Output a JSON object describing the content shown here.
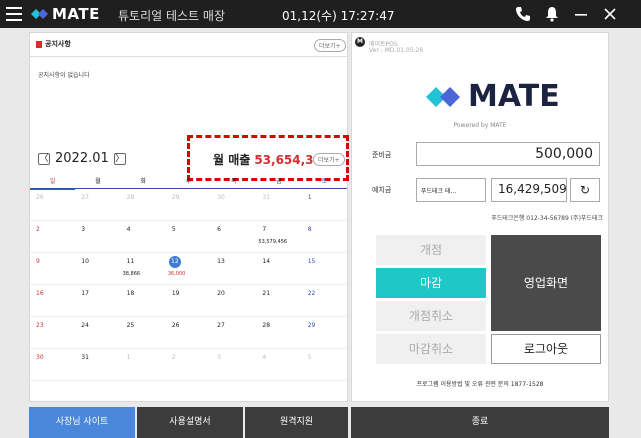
{
  "topbar": {
    "brand": "MATE",
    "store_name": "튜토리얼 테스트 매장",
    "clock": "01,12(수) 17:27:47",
    "icons": [
      "menu-icon",
      "phone-icon",
      "bell-icon",
      "minimize-icon",
      "close-icon"
    ]
  },
  "notice": {
    "title": "공지사항",
    "more": "더보기+",
    "empty": "공지사항이 없습니다"
  },
  "calendar": {
    "month": "2022.01",
    "prev": "〈",
    "next": "〉",
    "sales_label": "월 매출",
    "sales_amount": "53,654,322",
    "sales_more": "더보기+",
    "weekdays": [
      "일",
      "월",
      "화",
      "수",
      "목",
      "금",
      "토"
    ],
    "weeks": [
      [
        {
          "d": "26",
          "o": true
        },
        {
          "d": "27",
          "o": true
        },
        {
          "d": "28",
          "o": true
        },
        {
          "d": "29",
          "o": true
        },
        {
          "d": "30",
          "o": true
        },
        {
          "d": "31",
          "o": true
        },
        {
          "d": "1"
        }
      ],
      [
        {
          "d": "2"
        },
        {
          "d": "3"
        },
        {
          "d": "4"
        },
        {
          "d": "5"
        },
        {
          "d": "6"
        },
        {
          "d": "7",
          "v": "53,579,456"
        },
        {
          "d": "8"
        }
      ],
      [
        {
          "d": "9"
        },
        {
          "d": "10"
        },
        {
          "d": "11",
          "v": "38,866"
        },
        {
          "d": "12",
          "t": true,
          "v": "36,000",
          "r": true
        },
        {
          "d": "13"
        },
        {
          "d": "14"
        },
        {
          "d": "15"
        }
      ],
      [
        {
          "d": "16"
        },
        {
          "d": "17"
        },
        {
          "d": "18"
        },
        {
          "d": "19"
        },
        {
          "d": "20"
        },
        {
          "d": "21"
        },
        {
          "d": "22"
        }
      ],
      [
        {
          "d": "23"
        },
        {
          "d": "24"
        },
        {
          "d": "25"
        },
        {
          "d": "26"
        },
        {
          "d": "27"
        },
        {
          "d": "28"
        },
        {
          "d": "29"
        }
      ],
      [
        {
          "d": "30"
        },
        {
          "d": "31"
        },
        {
          "d": "1",
          "o": true
        },
        {
          "d": "2",
          "o": true
        },
        {
          "d": "3",
          "o": true
        },
        {
          "d": "4",
          "o": true
        },
        {
          "d": "5",
          "o": true
        }
      ]
    ]
  },
  "app": {
    "badge": "M",
    "name": "메이트POS",
    "version": "Ver : MD.01.05.26",
    "logo": "MATE",
    "powered": "Powered by MATE"
  },
  "cash": {
    "reserve_label": "준비금",
    "reserve_value": "500,000",
    "deposit_label": "예치금",
    "bank_button": "푸드테크 테...",
    "deposit_value": "16,429,509",
    "refresh": "↻",
    "bank_info": "푸드테크은행 012-34-56789 (주)푸드테크"
  },
  "operations": {
    "open": "개점",
    "close": "마감",
    "cancel_open": "개점취소",
    "cancel_close": "마감취소",
    "sales_screen": "영업화면",
    "logout": "로그아웃",
    "help": "프로그램 이용방법 및 오류 관련 문의 1877-1528"
  },
  "bottom": {
    "owner_site": "사장님 사이트",
    "manual": "사용설명서",
    "remote": "원격지원",
    "exit": "종료"
  },
  "colors": {
    "accent_teal": "#1fc7c7",
    "brand_dark": "#1c2340",
    "sales_red": "#d32f2f",
    "owner_blue": "#4a86d9"
  }
}
